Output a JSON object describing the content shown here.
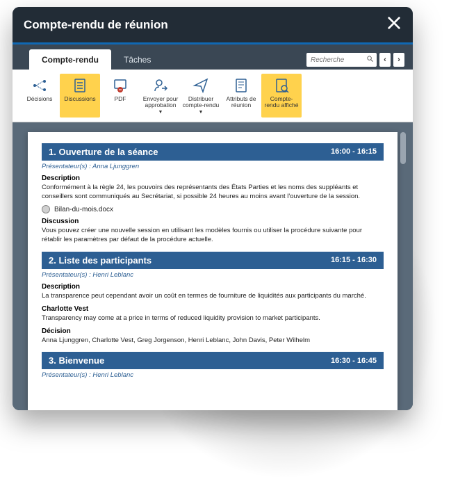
{
  "window": {
    "title": "Compte-rendu de réunion"
  },
  "tabs": {
    "t0": "Compte-rendu",
    "t1": "Tâches"
  },
  "search": {
    "placeholder": "Recherche"
  },
  "toolbar": {
    "decisions": "Décisions",
    "discussions": "Discussions",
    "pdf": "PDF",
    "send_approve": "Envoyer pour approbation",
    "distribute": "Distribuer compte-rendu",
    "attributes": "Attributs de réunion",
    "displayed": "Compte-rendu affiché"
  },
  "doc": {
    "s1": {
      "title": "1. Ouverture de la séance",
      "time": "16:00 - 16:15",
      "presenter": "Présentateur(s) : Anna Ljunggren",
      "desc_label": "Description",
      "desc": "Conformément à la règle 24, les pouvoirs des représentants des États Parties et les noms des suppléants et conseillers sont communiqués au Secrétariat, si possible 24 heures au moins avant l'ouverture de la session.",
      "attachment": "Bilan-du-mois.docx",
      "disc_label": "Discussion",
      "disc": "Vous pouvez créer une nouvelle session en utilisant les modèles fournis ou utiliser la procédure suivante pour rétablir les paramètres par défaut de la procédure actuelle."
    },
    "s2": {
      "title": "2. Liste des participants",
      "time": "16:15 - 16:30",
      "presenter": "Présentateur(s) : Henri Leblanc",
      "desc_label": "Description",
      "desc": "La transparence peut cependant avoir un coût en termes de fourniture de liquidités aux participants du marché.",
      "sub_label": "Charlotte Vest",
      "sub": "Transparency may come at a price in terms of reduced liquidity provision to market participants.",
      "dec_label": "Décision",
      "dec": "Anna Ljunggren, Charlotte Vest, Greg Jorgenson, Henri Leblanc, John Davis, Peter Wilhelm"
    },
    "s3": {
      "title": "3. Bienvenue",
      "time": "16:30 - 16:45",
      "presenter": "Présentateur(s) : Henri Leblanc"
    }
  }
}
